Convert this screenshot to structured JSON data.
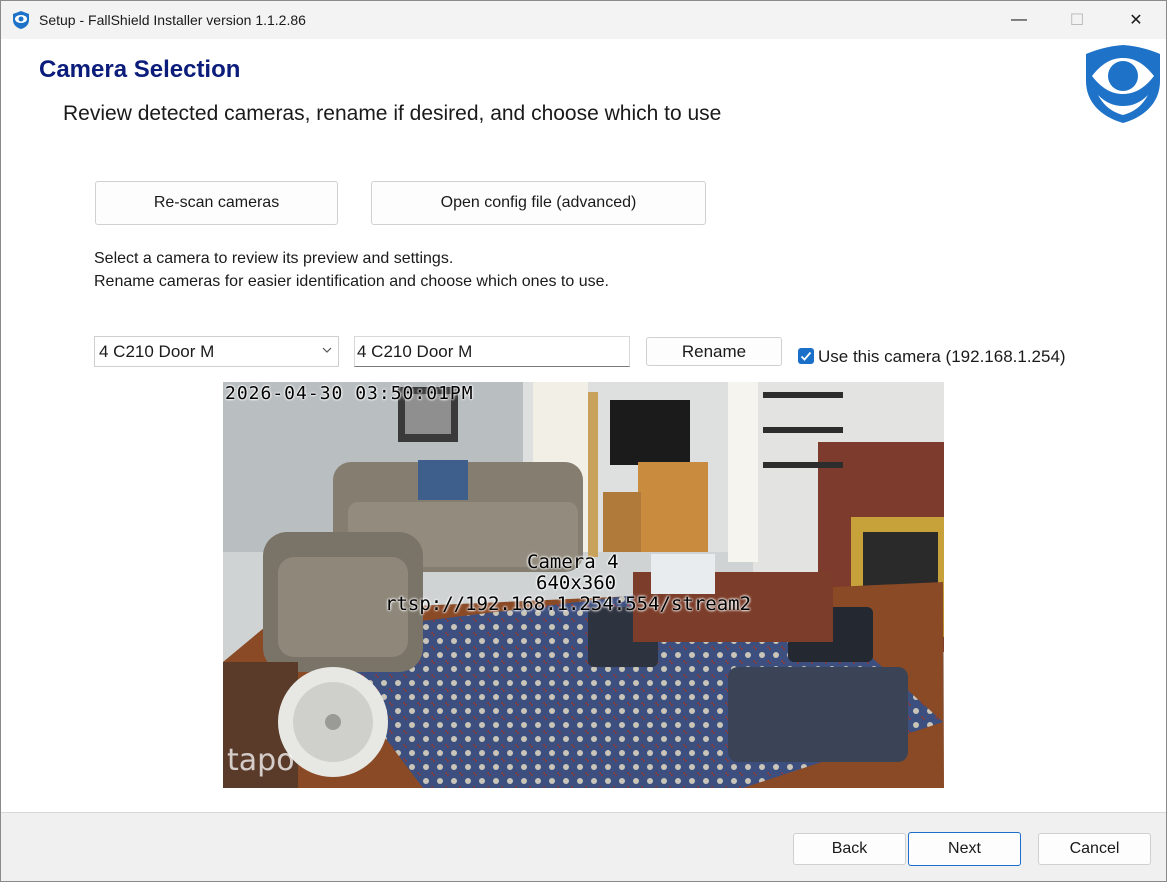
{
  "window": {
    "title": "Setup - FallShield Installer version 1.1.2.86",
    "minimize_glyph": "—",
    "maximize_glyph": "☐",
    "close_glyph": "✕"
  },
  "header": {
    "title": "Camera Selection",
    "subtitle": "Review detected cameras, rename if desired, and choose which to use"
  },
  "actions": {
    "rescan_label": "Re-scan cameras",
    "open_config_label": "Open config file (advanced)"
  },
  "instructions": {
    "line1": "Select a camera to review its preview and settings.",
    "line2": "Rename cameras for easier identification and choose which ones to use."
  },
  "camera": {
    "selected": "4 C210 Door M",
    "name_value": "4 C210 Door M",
    "rename_label": "Rename",
    "use_checked": true,
    "use_label": "Use this camera (192.168.1.254)"
  },
  "preview": {
    "timestamp": "2026-04-30 03:50:01PM",
    "camera_label": "Camera 4",
    "resolution": "640x360",
    "stream_url": "rtsp://192.168.1.254:554/stream2",
    "watermark": "tapo"
  },
  "footer": {
    "back_label": "Back",
    "next_label": "Next",
    "cancel_label": "Cancel"
  },
  "colors": {
    "accent": "#1a6fc9",
    "title": "#0b1c7a",
    "logo": "#1e73c8"
  },
  "icons": {
    "app": "shield-eye-icon",
    "logo": "shield-eye-logo",
    "dropdown": "chevron-down-icon",
    "checkbox": "checkmark-icon"
  }
}
